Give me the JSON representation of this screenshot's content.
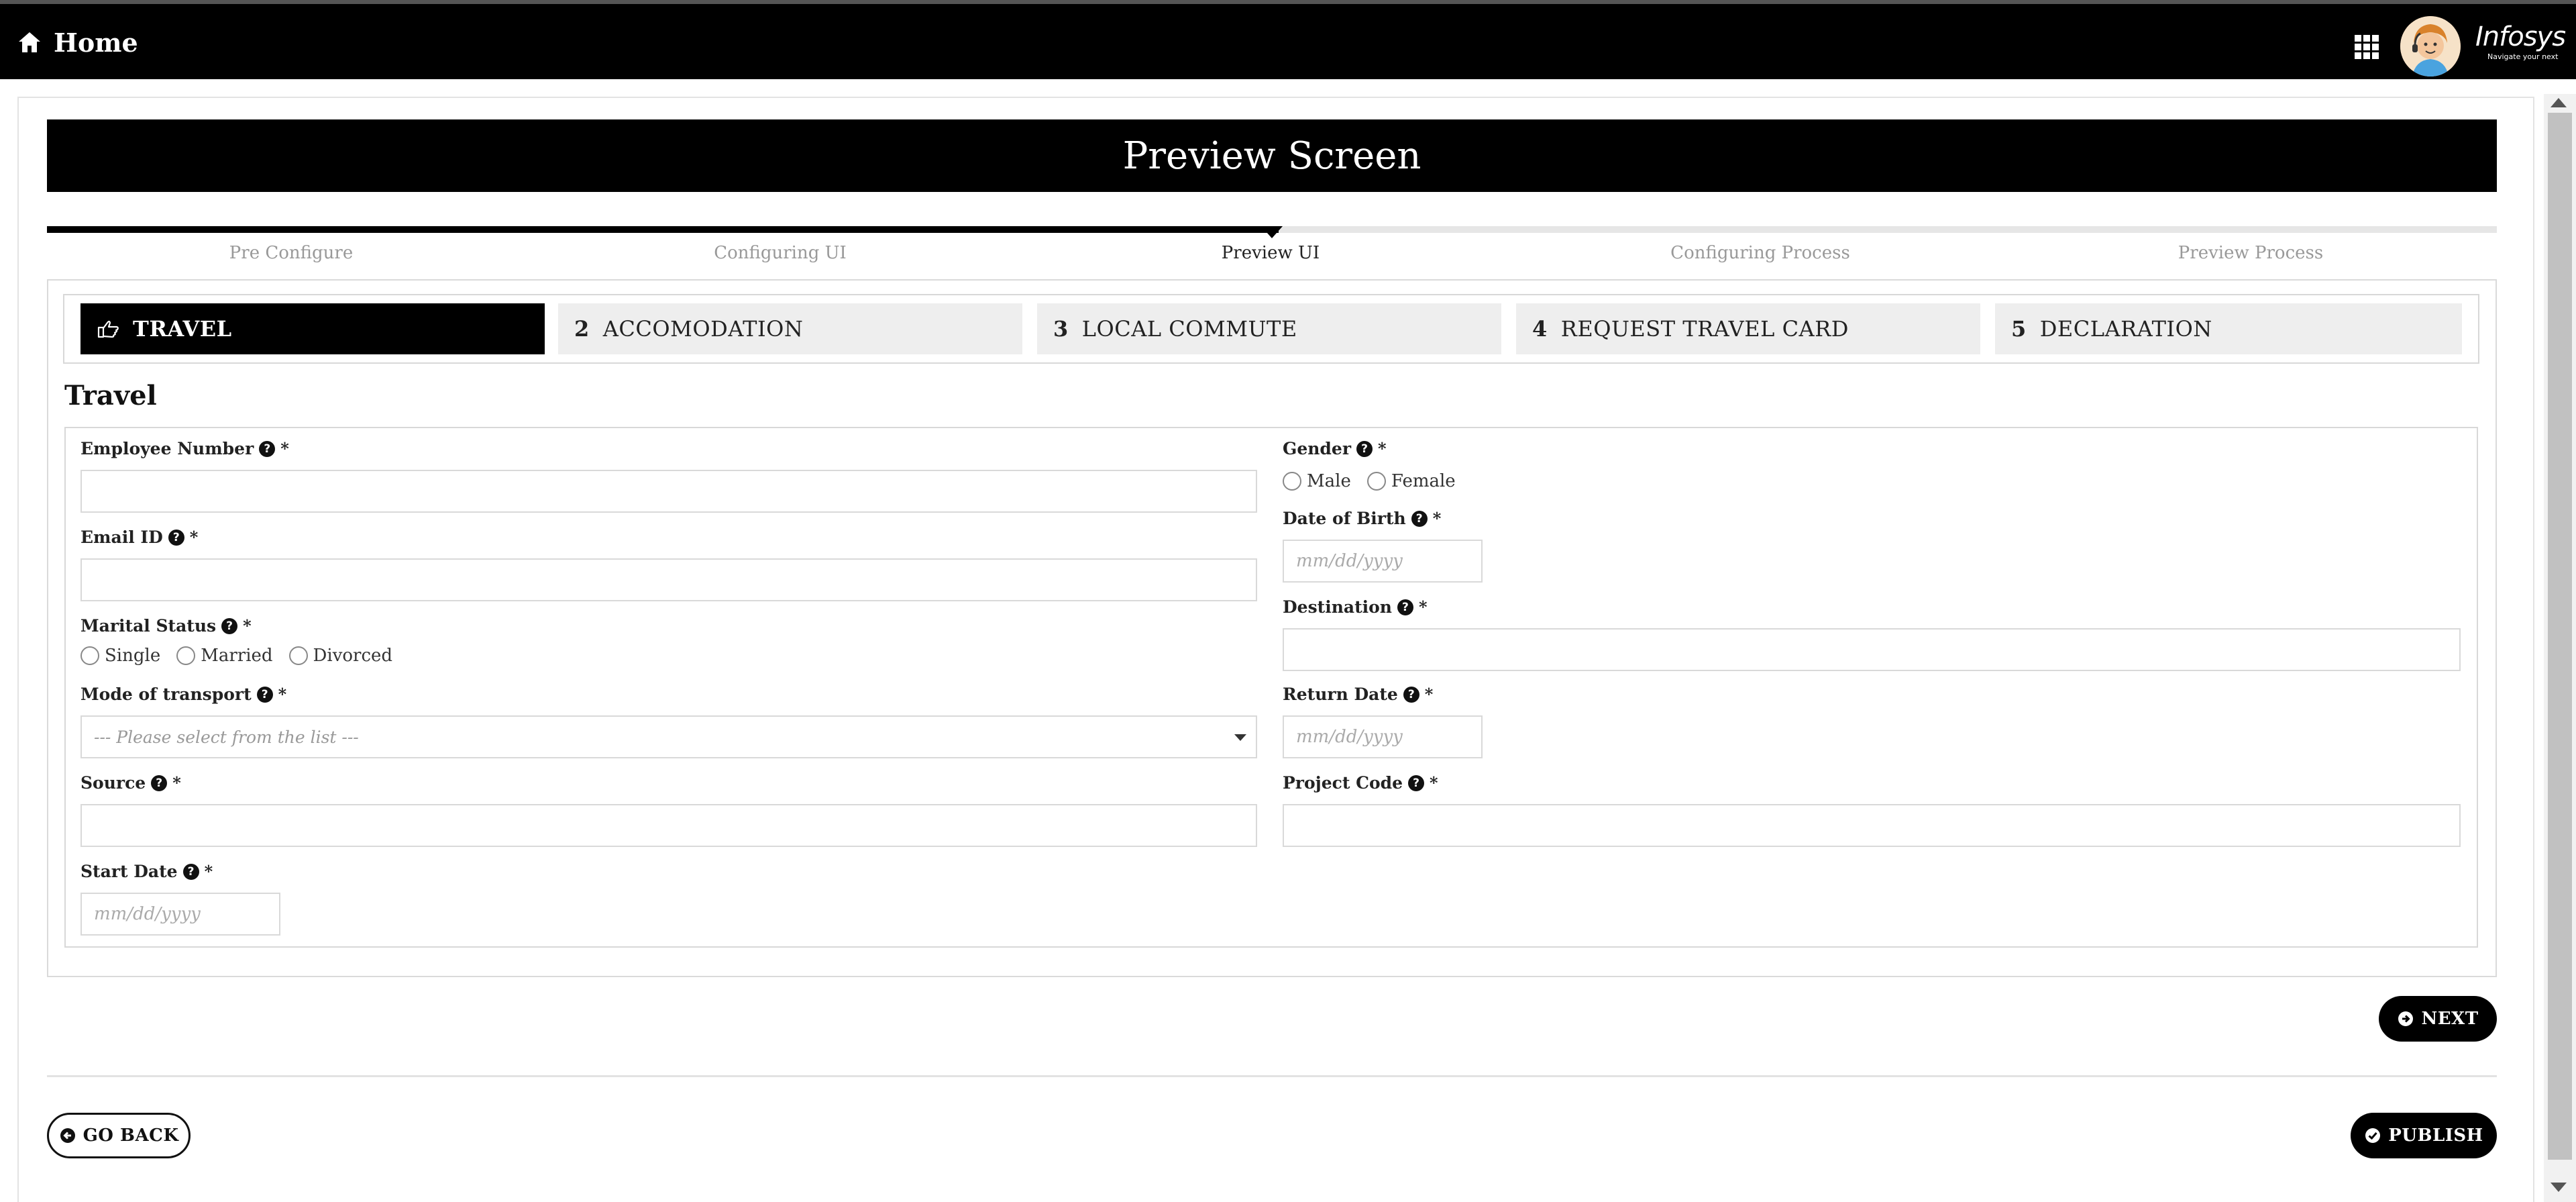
{
  "topbar": {
    "home_label": "Home",
    "brand_logo": "Infosys",
    "brand_tagline": "Navigate your next",
    "icons": [
      "home-icon",
      "apps-grid-icon",
      "avatar"
    ]
  },
  "page": {
    "title": "Preview Screen"
  },
  "wizard": {
    "steps": [
      {
        "label": "Pre Configure",
        "active": false
      },
      {
        "label": "Configuring UI",
        "active": false
      },
      {
        "label": "Preview UI",
        "active": true
      },
      {
        "label": "Configuring Process",
        "active": false
      },
      {
        "label": "Preview Process",
        "active": false
      }
    ]
  },
  "tabs": [
    {
      "num": "",
      "label": "TRAVEL",
      "active": true,
      "icon": "hand-point-right-icon"
    },
    {
      "num": "2",
      "label": "ACCOMODATION",
      "active": false
    },
    {
      "num": "3",
      "label": "LOCAL COMMUTE",
      "active": false
    },
    {
      "num": "4",
      "label": "REQUEST TRAVEL CARD",
      "active": false
    },
    {
      "num": "5",
      "label": "DECLARATION",
      "active": false
    }
  ],
  "form": {
    "section_title": "Travel",
    "required_mark": "*",
    "help_icon": "?",
    "employee_number": {
      "label": "Employee Number",
      "value": ""
    },
    "email_id": {
      "label": "Email ID",
      "value": ""
    },
    "marital_status": {
      "label": "Marital Status",
      "options": [
        "Single",
        "Married",
        "Divorced"
      ]
    },
    "mode_of_transport": {
      "label": "Mode of transport",
      "placeholder": "--- Please select from the list ---"
    },
    "source": {
      "label": "Source",
      "value": ""
    },
    "start_date": {
      "label": "Start Date",
      "placeholder": "mm/dd/yyyy"
    },
    "gender": {
      "label": "Gender",
      "options": [
        "Male",
        "Female"
      ]
    },
    "date_of_birth": {
      "label": "Date of Birth",
      "placeholder": "mm/dd/yyyy"
    },
    "destination": {
      "label": "Destination",
      "value": ""
    },
    "return_date": {
      "label": "Return Date",
      "placeholder": "mm/dd/yyyy"
    },
    "project_code": {
      "label": "Project Code",
      "value": ""
    }
  },
  "buttons": {
    "next": "NEXT",
    "go_back": "GO BACK",
    "publish": "PUBLISH"
  },
  "colors": {
    "primary": "#000000",
    "tab_inactive": "#eeeeee",
    "border": "#d9d9d9"
  }
}
